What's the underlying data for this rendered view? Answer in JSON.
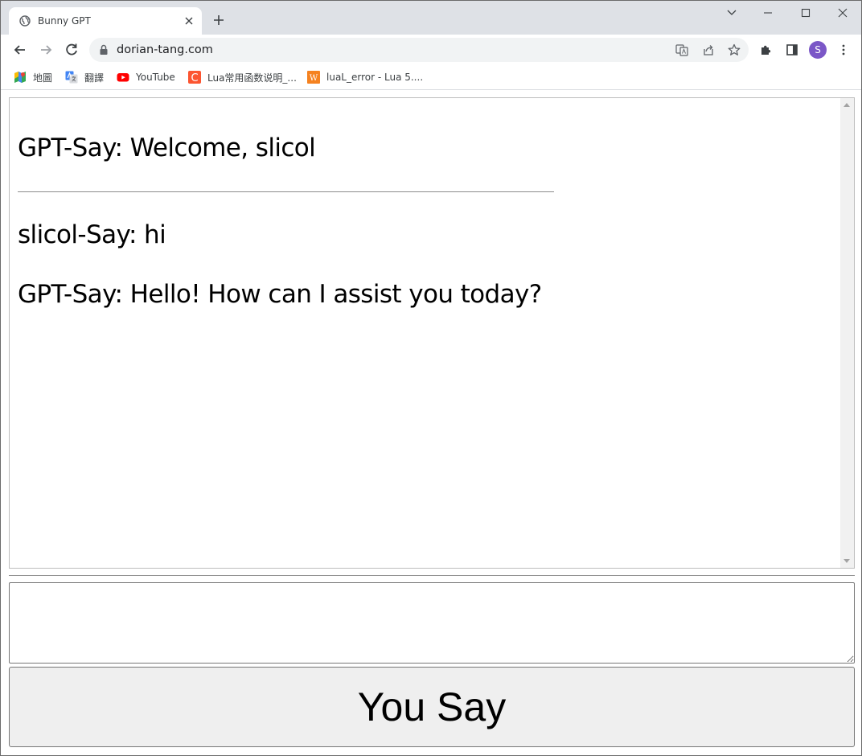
{
  "browser": {
    "tab_title": "Bunny GPT",
    "url": "dorian-tang.com",
    "avatar_initial": "S",
    "bookmarks": [
      {
        "label": "地圖",
        "icon": "google-maps-icon"
      },
      {
        "label": "翻譯",
        "icon": "google-translate-icon"
      },
      {
        "label": "YouTube",
        "icon": "youtube-icon"
      },
      {
        "label": "Lua常用函数说明_...",
        "icon": "csdn-icon",
        "icon_text": "C"
      },
      {
        "label": "luaL_error - Lua 5....",
        "icon": "w-site-icon",
        "icon_text": "W"
      }
    ]
  },
  "chat": {
    "messages": [
      {
        "text": "GPT-Say: Welcome, slicol"
      },
      {
        "text": "slicol-Say: hi"
      },
      {
        "text": "GPT-Say: Hello! How can I assist you today?"
      }
    ]
  },
  "composer": {
    "input_value": "",
    "send_label": "You Say"
  },
  "colors": {
    "avatar": "#7b57c7",
    "youtube_red": "#ff0000",
    "csdn_red": "#fc5531",
    "w_orange": "#f58220",
    "button_bg": "#efefef"
  }
}
